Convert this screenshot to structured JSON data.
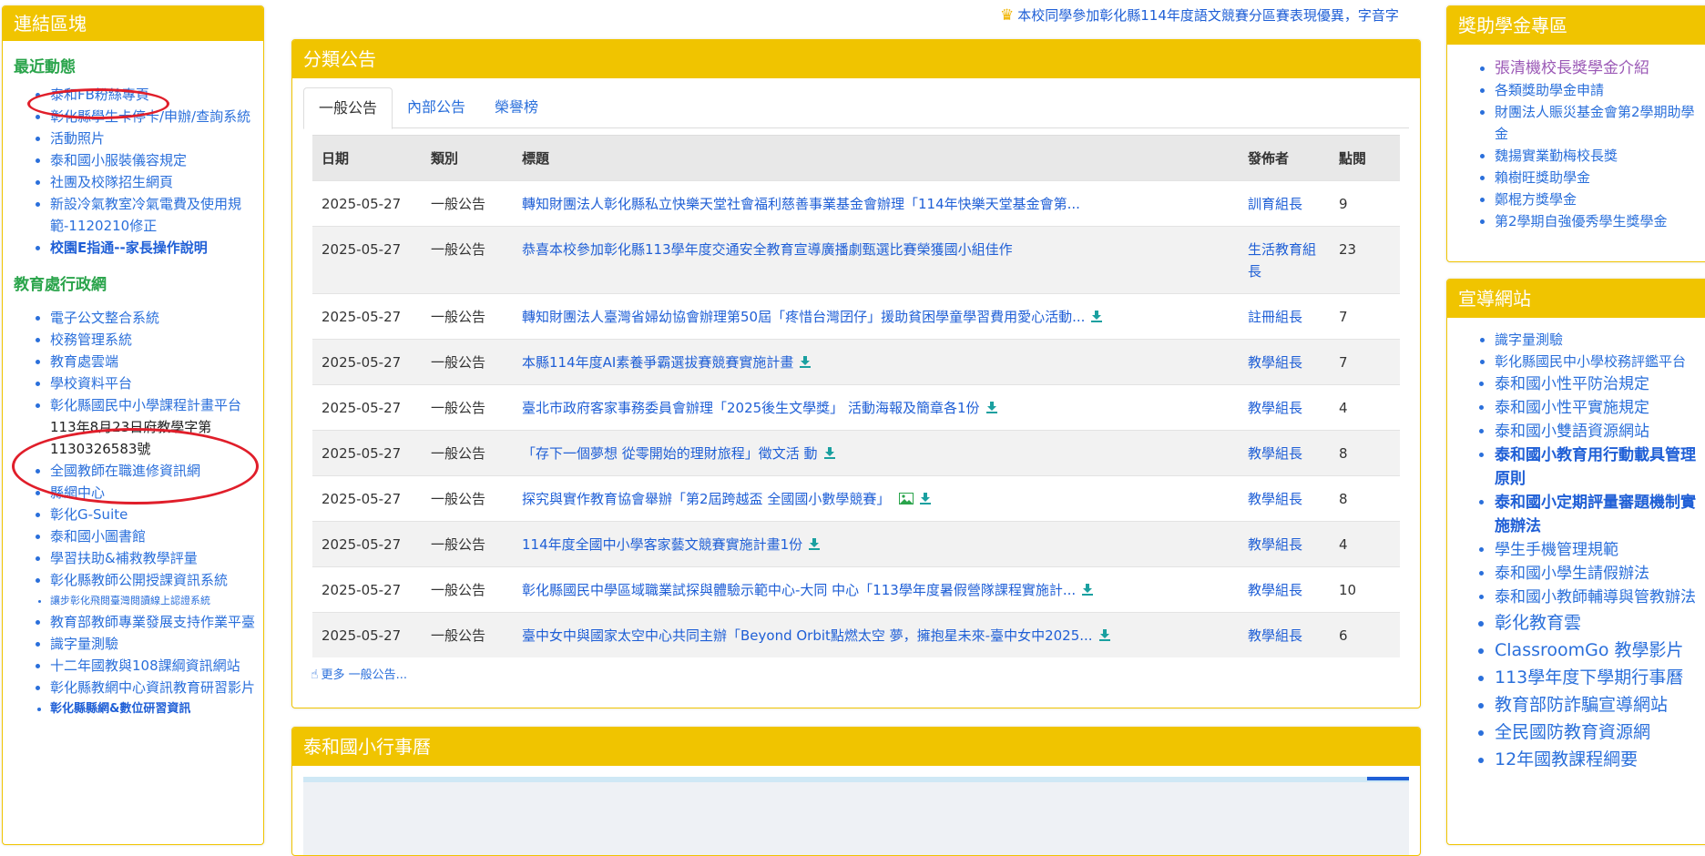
{
  "left": {
    "header": "連結區塊",
    "recent_title": "最近動態",
    "recent_items": [
      "泰和FB粉絲專頁",
      "彰化縣學生卡停卡/申辦/查詢系統",
      "活動照片",
      "泰和國小服裝儀容規定",
      "社團及校隊招生網頁",
      "新設冷氣教室冷氣電費及使用規範-1120210修正",
      "校園E指通--家長操作說明"
    ],
    "edu_title": "教育處行政網",
    "edu_items": [
      "電子公文整合系統",
      "校務管理系統",
      "教育處雲端",
      "學校資料平台",
      "彰化縣國民中小學課程計畫平台",
      "113年8月23日府教學字第1130326583號",
      "全國教師在職進修資訊網",
      "縣網中心",
      "彰化G-Suite",
      "泰和國小圖書館",
      "學習扶助&補救教學評量",
      "彰化縣教師公開授課資訊系統",
      "讓步彰化飛閱臺灣閱讀線上認證系統",
      "教育部教師專業發展支持作業平臺",
      "識字量測驗",
      "十二年國教與108課綱資訊網站",
      "彰化縣教網中心資訊教育研習影片",
      "彰化縣縣網&數位研習資訊"
    ]
  },
  "marquee": {
    "text": "本校同學參加彰化縣114年度語文競賽分區賽表現優異，字音字"
  },
  "announcements": {
    "header": "分類公告",
    "tabs": [
      "一般公告",
      "內部公告",
      "榮譽榜"
    ],
    "columns": [
      "日期",
      "類別",
      "標題",
      "發佈者",
      "點閱"
    ],
    "rows": [
      {
        "date": "2025-05-27",
        "cat": "一般公告",
        "title": "轉知財團法人彰化縣私立快樂天堂社會福利慈善事業基金會辦理「114年快樂天堂基金會第...",
        "pub": "訓育組長",
        "views": "9",
        "dl": false,
        "img": false
      },
      {
        "date": "2025-05-27",
        "cat": "一般公告",
        "title": "恭喜本校參加彰化縣113學年度交通安全教育宣導廣播劇甄選比賽榮獲國小組佳作",
        "pub": "生活教育組長",
        "views": "23",
        "dl": false,
        "img": false
      },
      {
        "date": "2025-05-27",
        "cat": "一般公告",
        "title": "轉知財團法人臺灣省婦幼協會辦理第50屆「疼惜台灣囝仔」援助貧困學童學習費用愛心活動...",
        "pub": "註冊組長",
        "views": "7",
        "dl": true,
        "img": false
      },
      {
        "date": "2025-05-27",
        "cat": "一般公告",
        "title": "本縣114年度AI素養爭霸選拔賽競賽實施計畫",
        "pub": "教學組長",
        "views": "7",
        "dl": true,
        "img": false
      },
      {
        "date": "2025-05-27",
        "cat": "一般公告",
        "title": "臺北市政府客家事務委員會辦理「2025後生文學獎」 活動海報及簡章各1份",
        "pub": "教學組長",
        "views": "4",
        "dl": true,
        "img": false
      },
      {
        "date": "2025-05-27",
        "cat": "一般公告",
        "title": "「存下一個夢想 從零開始的理財旅程」徵文活 動",
        "pub": "教學組長",
        "views": "8",
        "dl": true,
        "img": false
      },
      {
        "date": "2025-05-27",
        "cat": "一般公告",
        "title": "探究與實作教育協會舉辦「第2屆跨越盃 全國國小數學競賽」",
        "pub": "教學組長",
        "views": "8",
        "dl": true,
        "img": true
      },
      {
        "date": "2025-05-27",
        "cat": "一般公告",
        "title": "114年度全國中小學客家藝文競賽實施計畫1份",
        "pub": "教學組長",
        "views": "4",
        "dl": true,
        "img": false
      },
      {
        "date": "2025-05-27",
        "cat": "一般公告",
        "title": "彰化縣國民中學區域職業試探與體驗示範中心-大同 中心「113學年度暑假營隊課程實施計...",
        "pub": "教學組長",
        "views": "10",
        "dl": true,
        "img": false
      },
      {
        "date": "2025-05-27",
        "cat": "一般公告",
        "title": "臺中女中與國家太空中心共同主辦「Beyond Orbit點燃太空 夢，擁抱星未來-臺中女中2025...",
        "pub": "教學組長",
        "views": "6",
        "dl": true,
        "img": false
      }
    ],
    "more": "更多 一般公告..."
  },
  "calendar": {
    "header": "泰和國小行事曆"
  },
  "scholarship": {
    "header": "獎助學金專區",
    "items": [
      "張清機校長獎學金介紹",
      "各類獎助學金申請",
      "財團法人賑災基金會第2學期助學金",
      "魏揚實業勤梅校長獎",
      "賴樹旺獎助學金",
      "鄭棍方獎學金",
      "第2學期自強優秀學生獎學金"
    ]
  },
  "promo": {
    "header": "宣導網站",
    "items": [
      "識字量測驗",
      "彰化縣國民中小學校務評鑑平台",
      "泰和國小性平防治規定",
      "泰和國小性平實施規定",
      "泰和國小雙語資源網站",
      "泰和國小教育用行動載具管理原則",
      "泰和國小定期評量審題機制實施辦法",
      "學生手機管理規範",
      "泰和國小學生請假辦法",
      "泰和國小教師輔導與管教辦法",
      "彰化教育雲",
      "ClassroomGo 教學影片",
      "113學年度下學期行事曆",
      "教育部防詐騙宣導網站",
      "全民國防教育資源網",
      "12年國教課程綱要"
    ]
  },
  "colors": {
    "panel": "#f0c400",
    "link": "#1f5fd6",
    "green": "#2aa44b",
    "annotation": "#e01e2a"
  }
}
